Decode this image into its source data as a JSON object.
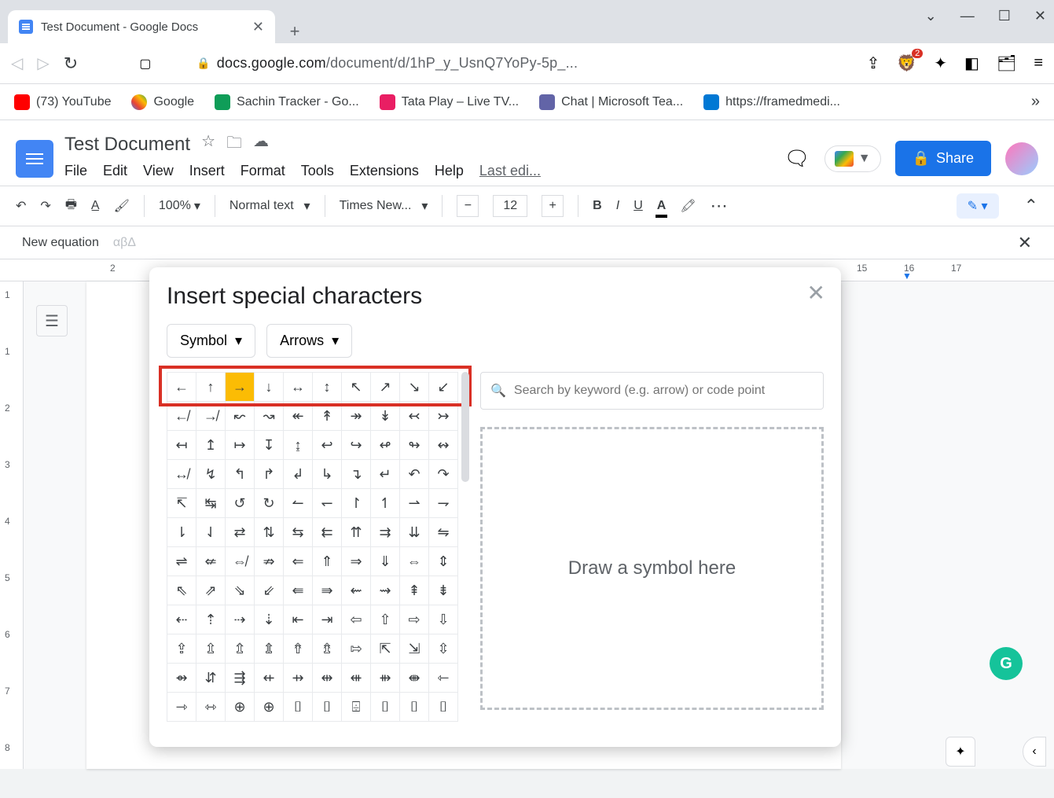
{
  "browser": {
    "tab_title": "Test Document - Google Docs",
    "url_host": "docs.google.com",
    "url_path": "/document/d/1hP_y_UsnQ7YoPy-5p_...",
    "brave_count": "2"
  },
  "bookmarks": {
    "youtube": "(73) YouTube",
    "google": "Google",
    "tracker": "Sachin Tracker - Go...",
    "tata": "Tata Play – Live TV...",
    "teams": "Chat | Microsoft Tea...",
    "framed": "https://framedmedi..."
  },
  "docs": {
    "title": "Test Document",
    "menus": [
      "File",
      "Edit",
      "View",
      "Insert",
      "Format",
      "Tools",
      "Extensions",
      "Help"
    ],
    "last_edit": "Last edi...",
    "share": "Share"
  },
  "toolbar": {
    "zoom": "100%",
    "style": "Normal text",
    "font": "Times New...",
    "size": "12"
  },
  "equation": {
    "label": "New equation",
    "greek": "αβΔ"
  },
  "ruler": {
    "left": "2",
    "marks": [
      "15",
      "16",
      "17"
    ]
  },
  "vruler": [
    "1",
    "1",
    "2",
    "3",
    "4",
    "5",
    "6",
    "7",
    "8"
  ],
  "modal": {
    "title": "Insert special characters",
    "category": "Symbol",
    "subcategory": "Arrows",
    "search_placeholder": "Search by keyword (e.g. arrow) or code point",
    "draw_hint": "Draw a symbol here",
    "grid": [
      [
        "←",
        "↑",
        "→",
        "↓",
        "↔",
        "↕",
        "↖",
        "↗",
        "↘",
        "↙"
      ],
      [
        "↚",
        "↛",
        "↜",
        "↝",
        "↞",
        "↟",
        "↠",
        "↡",
        "↢",
        "↣"
      ],
      [
        "↤",
        "↥",
        "↦",
        "↧",
        "↨",
        "↩",
        "↪",
        "↫",
        "↬",
        "↭"
      ],
      [
        "↮",
        "↯",
        "↰",
        "↱",
        "↲",
        "↳",
        "↴",
        "↵",
        "↶",
        "↷"
      ],
      [
        "↸",
        "↹",
        "↺",
        "↻",
        "↼",
        "↽",
        "↾",
        "↿",
        "⇀",
        "⇁"
      ],
      [
        "⇂",
        "⇃",
        "⇄",
        "⇅",
        "⇆",
        "⇇",
        "⇈",
        "⇉",
        "⇊",
        "⇋"
      ],
      [
        "⇌",
        "⇍",
        "⇎",
        "⇏",
        "⇐",
        "⇑",
        "⇒",
        "⇓",
        "⇔",
        "⇕"
      ],
      [
        "⇖",
        "⇗",
        "⇘",
        "⇙",
        "⇚",
        "⇛",
        "⇜",
        "⇝",
        "⇞",
        "⇟"
      ],
      [
        "⇠",
        "⇡",
        "⇢",
        "⇣",
        "⇤",
        "⇥",
        "⇦",
        "⇧",
        "⇨",
        "⇩"
      ],
      [
        "⇪",
        "⇫",
        "⇬",
        "⇭",
        "⇮",
        "⇯",
        "⇰",
        "⇱",
        "⇲",
        "⇳"
      ],
      [
        "⇴",
        "⇵",
        "⇶",
        "⇷",
        "⇸",
        "⇹",
        "⇺",
        "⇻",
        "⇼",
        "⇽"
      ],
      [
        "⇾",
        "⇿",
        "⊕",
        "⊕",
        "⌷",
        "⌷",
        "⌹",
        "⌷",
        "⌷",
        "⌷"
      ]
    ],
    "hovered": {
      "row": 0,
      "col": 2
    }
  },
  "grammarly": "G"
}
